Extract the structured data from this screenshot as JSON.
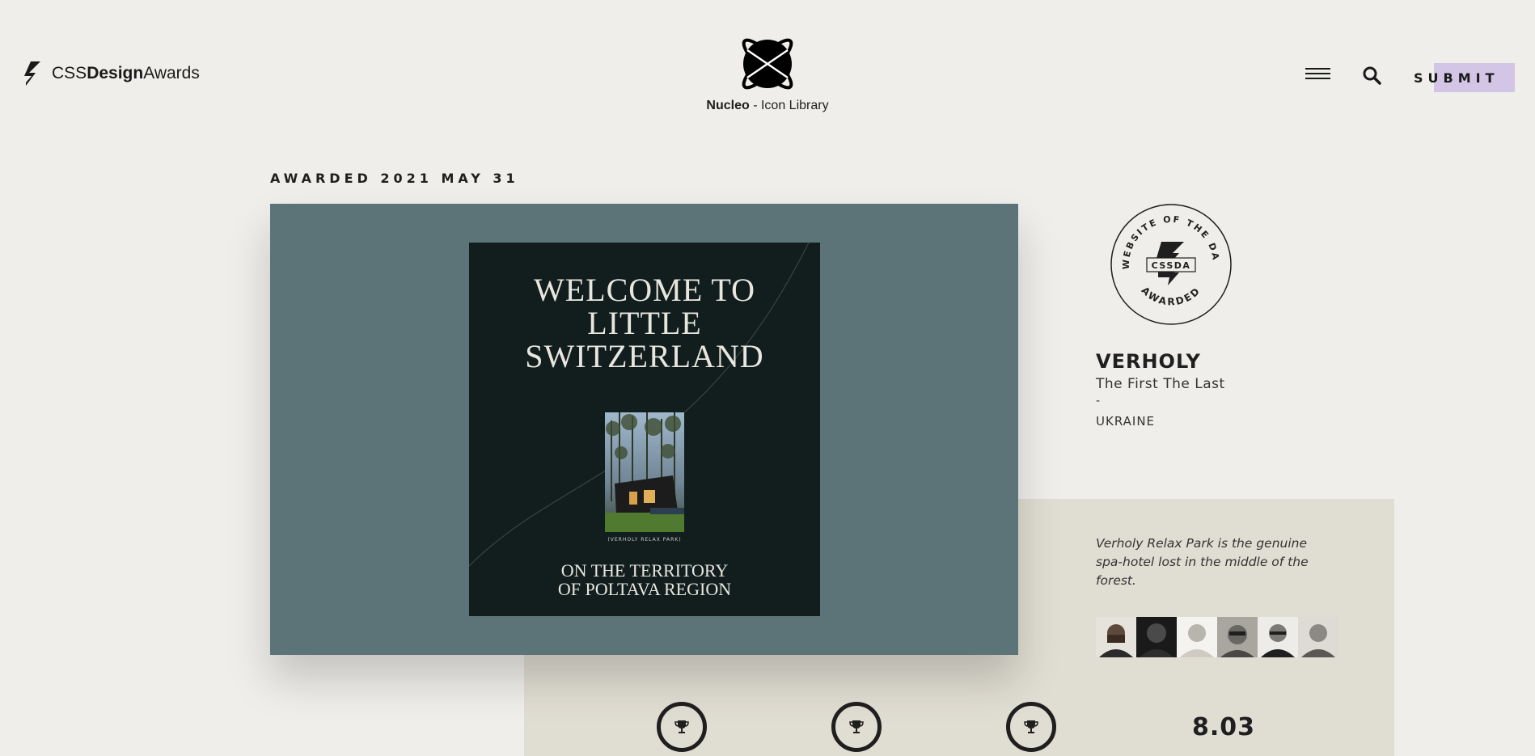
{
  "header": {
    "logo_prefix": "CSS",
    "logo_bold": "Design",
    "logo_suffix": "Awards",
    "sponsor_name": "Nucleo",
    "sponsor_rest": " - Icon Library",
    "submit_label": "SUBMIT"
  },
  "award": {
    "date_label": "AWARDED 2021 MAY 31",
    "badge_top_text": "WEBSITE OF THE DAY",
    "badge_center_text": "CSSDA",
    "badge_bottom_text": "AWARDED"
  },
  "poster": {
    "title_line1": "WELCOME TO",
    "title_line2": "LITTLE",
    "title_line3": "SWITZERLAND",
    "caption": "(VERHOLY RELAX PARK)",
    "sub_line1": "ON THE TERRITORY",
    "sub_line2": "OF POLTAVA REGION"
  },
  "site": {
    "name": "VERHOLY",
    "agency": "The First The Last",
    "separator": "-",
    "country": "UKRAINE",
    "description": "Verholy Relax Park is the genuine spa-hotel lost in the middle of the forest."
  },
  "jury": {
    "count": 6
  },
  "scores": {
    "overall": "8.03"
  },
  "colors": {
    "background": "#efeeea",
    "beige_panel": "#e0ddd2",
    "screenshot_bg": "#5c7477",
    "poster_bg": "#121e1e",
    "submit_highlight": "#d3c5e6"
  }
}
